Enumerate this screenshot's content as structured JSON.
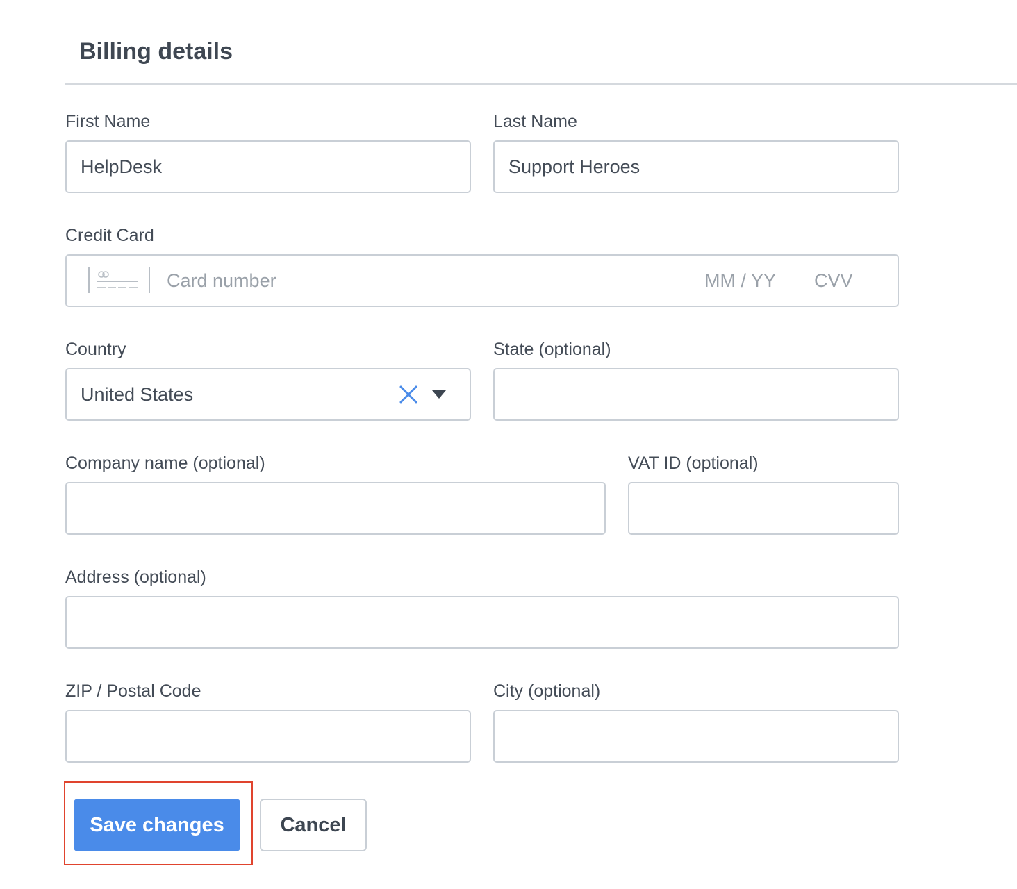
{
  "page": {
    "title": "Billing details"
  },
  "form": {
    "first_name": {
      "label": "First Name",
      "value": "HelpDesk"
    },
    "last_name": {
      "label": "Last Name",
      "value": "Support Heroes"
    },
    "credit_card": {
      "label": "Credit Card",
      "number_placeholder": "Card number",
      "expiry_placeholder": "MM / YY",
      "cvv_placeholder": "CVV",
      "icon": "credit-card-icon"
    },
    "country": {
      "label": "Country",
      "value": "United States",
      "clear_icon": "close-icon",
      "dropdown_icon": "chevron-down-icon"
    },
    "state": {
      "label": "State (optional)",
      "value": ""
    },
    "company_name": {
      "label": "Company name (optional)",
      "value": ""
    },
    "vat_id": {
      "label": "VAT ID (optional)",
      "value": ""
    },
    "address": {
      "label": "Address (optional)",
      "value": ""
    },
    "zip": {
      "label": "ZIP / Postal Code",
      "value": ""
    },
    "city": {
      "label": "City (optional)",
      "value": ""
    }
  },
  "actions": {
    "save_label": "Save changes",
    "cancel_label": "Cancel"
  },
  "colors": {
    "primary": "#4a8be9",
    "highlight": "#e0442e",
    "clear_icon": "#4a8be9",
    "border": "#c9cfd6",
    "text": "#3d4651",
    "placeholder": "#9aa1a9"
  }
}
